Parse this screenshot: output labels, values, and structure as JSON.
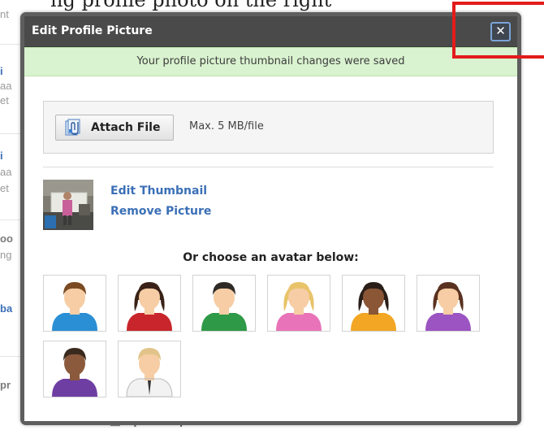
{
  "background": {
    "top_fragment": "ng profile photo on the right",
    "side_fragments": [
      {
        "text": "nt",
        "style": "light"
      },
      {
        "text": "i",
        "style": "blue"
      },
      {
        "text": "aa",
        "style": "light"
      },
      {
        "text": "et",
        "style": "light"
      },
      {
        "text": "i",
        "style": "blue"
      },
      {
        "text": "aa",
        "style": "light"
      },
      {
        "text": "et",
        "style": "light"
      },
      {
        "text": "oo",
        "style": "normal"
      },
      {
        "text": "ng",
        "style": "light"
      },
      {
        "text": "ba",
        "style": "blue"
      },
      {
        "text": "pr",
        "style": "normal"
      }
    ],
    "upload_text": "Upload a photo"
  },
  "modal": {
    "title": "Edit Profile Picture",
    "close_symbol": "✕",
    "success_message": "Your profile picture thumbnail changes were saved",
    "attach_button_label": "Attach File",
    "attach_hint": "Max. 5 MB/file",
    "edit_thumbnail_label": "Edit Thumbnail",
    "remove_picture_label": "Remove Picture",
    "avatar_heading": "Or choose an avatar below:"
  },
  "avatars": [
    {
      "name": "avatar-man-blue-shirt",
      "hair": "#7a4a22",
      "skin": "#f6cda4",
      "shirt": "#2a8fd4"
    },
    {
      "name": "avatar-woman-red-shirt",
      "hair": "#3a2218",
      "skin": "#f6cda4",
      "shirt": "#c8262c"
    },
    {
      "name": "avatar-man-green-shirt",
      "hair": "#2f2a26",
      "skin": "#f6cda4",
      "shirt": "#2e9a47"
    },
    {
      "name": "avatar-woman-pink-shirt",
      "hair": "#e8c36a",
      "skin": "#f6cda4",
      "shirt": "#e873b8"
    },
    {
      "name": "avatar-woman-orange-shirt",
      "hair": "#2a1f18",
      "skin": "#8a5636",
      "shirt": "#f2a623"
    },
    {
      "name": "avatar-woman-purple-shirt",
      "hair": "#5a3220",
      "skin": "#f6cda4",
      "shirt": "#9b54c2"
    },
    {
      "name": "avatar-man-purple-shirt",
      "hair": "#3a2a1e",
      "skin": "#8b5a3c",
      "shirt": "#6e3ea3"
    },
    {
      "name": "avatar-man-white-shirt",
      "hair": "#e2c48a",
      "skin": "#f6cda4",
      "shirt": "#f2f2f2"
    }
  ],
  "colors": {
    "modal_header": "#4a4a4a",
    "success_bg": "#d9f2cf",
    "link": "#3b6fb6",
    "highlight": "#e31b1b"
  }
}
